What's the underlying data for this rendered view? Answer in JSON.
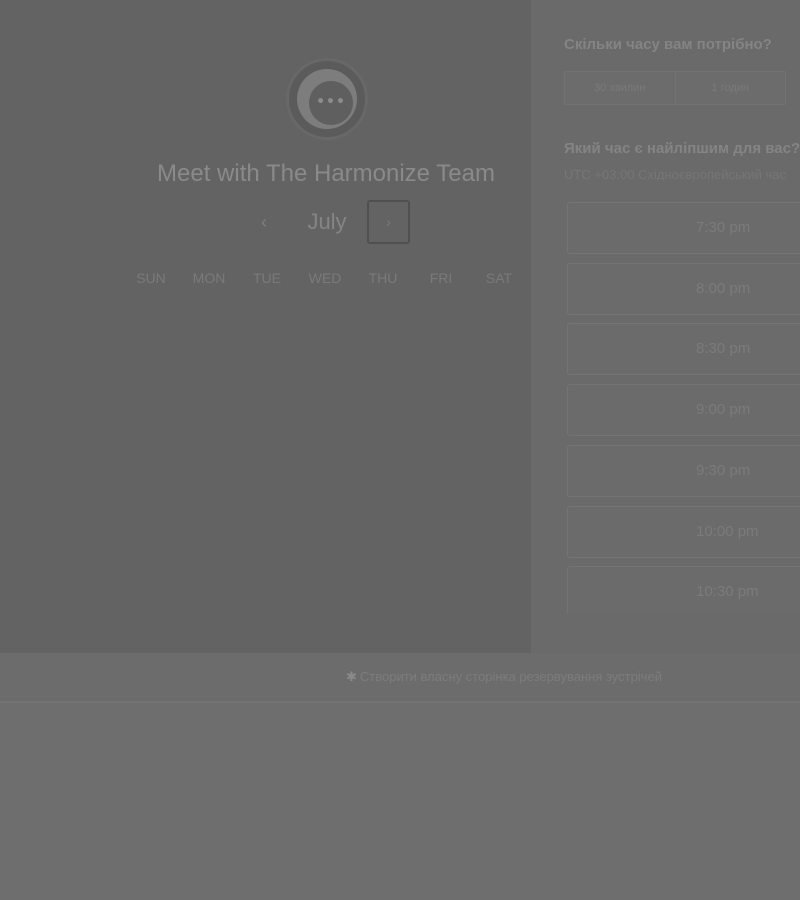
{
  "calendar": {
    "title": "Meet with The Harmonize Team",
    "month": "July",
    "prev_label": "‹",
    "next_label": "›",
    "weekdays": [
      "SUN",
      "MON",
      "TUE",
      "WED",
      "THU",
      "FRI",
      "SAT"
    ]
  },
  "avatar": {
    "dots": "•••",
    "icon": "chat-bubble-icon"
  },
  "duration": {
    "question": "Скільки часу вам потрібно?",
    "options": [
      "30 хвилин",
      "1 годин"
    ]
  },
  "time_selection": {
    "question": "Який час є найліпшим для вас?",
    "timezone": "UTC +03:00 Східноєвропейський час",
    "slots": [
      "7:30 pm",
      "8:00 pm",
      "8:30 pm",
      "9:00 pm",
      "9:30 pm",
      "10:00 pm",
      "10:30 pm"
    ]
  },
  "footer": {
    "icon": "sprocket-icon",
    "link_text": "Створити власну сторінка резервування зустрічей"
  },
  "colors": {
    "overlay_left": "#636363",
    "overlay_right": "#6a6a6a",
    "background": "#6e6e6e"
  }
}
